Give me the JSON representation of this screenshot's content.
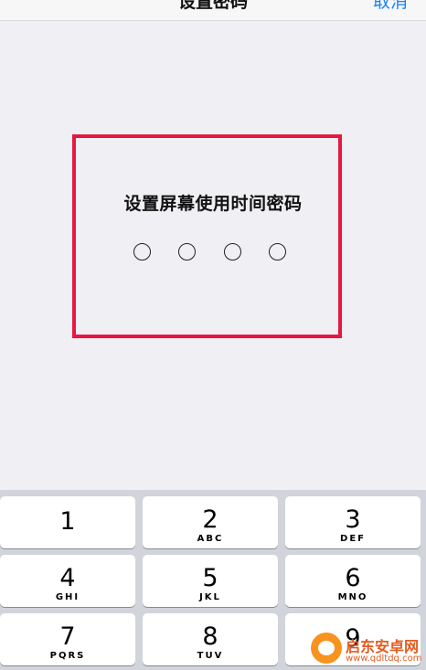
{
  "header": {
    "title": "设置密码",
    "cancel_label": "取消"
  },
  "passcode": {
    "prompt": "设置屏幕使用时间密码",
    "digit_count": 4,
    "entered_count": 0
  },
  "keypad": {
    "keys": [
      {
        "number": "1",
        "letters": ""
      },
      {
        "number": "2",
        "letters": "ABC"
      },
      {
        "number": "3",
        "letters": "DEF"
      },
      {
        "number": "4",
        "letters": "GHI"
      },
      {
        "number": "5",
        "letters": "JKL"
      },
      {
        "number": "6",
        "letters": "MNO"
      },
      {
        "number": "7",
        "letters": "PQRS"
      },
      {
        "number": "8",
        "letters": "TUV"
      },
      {
        "number": "9",
        "letters": ""
      }
    ]
  },
  "watermark": {
    "title": "启东安卓网",
    "url": "www.qdltdq.com"
  },
  "colors": {
    "highlight": "#e8173f",
    "accent": "#1a82fb",
    "background": "#efeff4"
  }
}
